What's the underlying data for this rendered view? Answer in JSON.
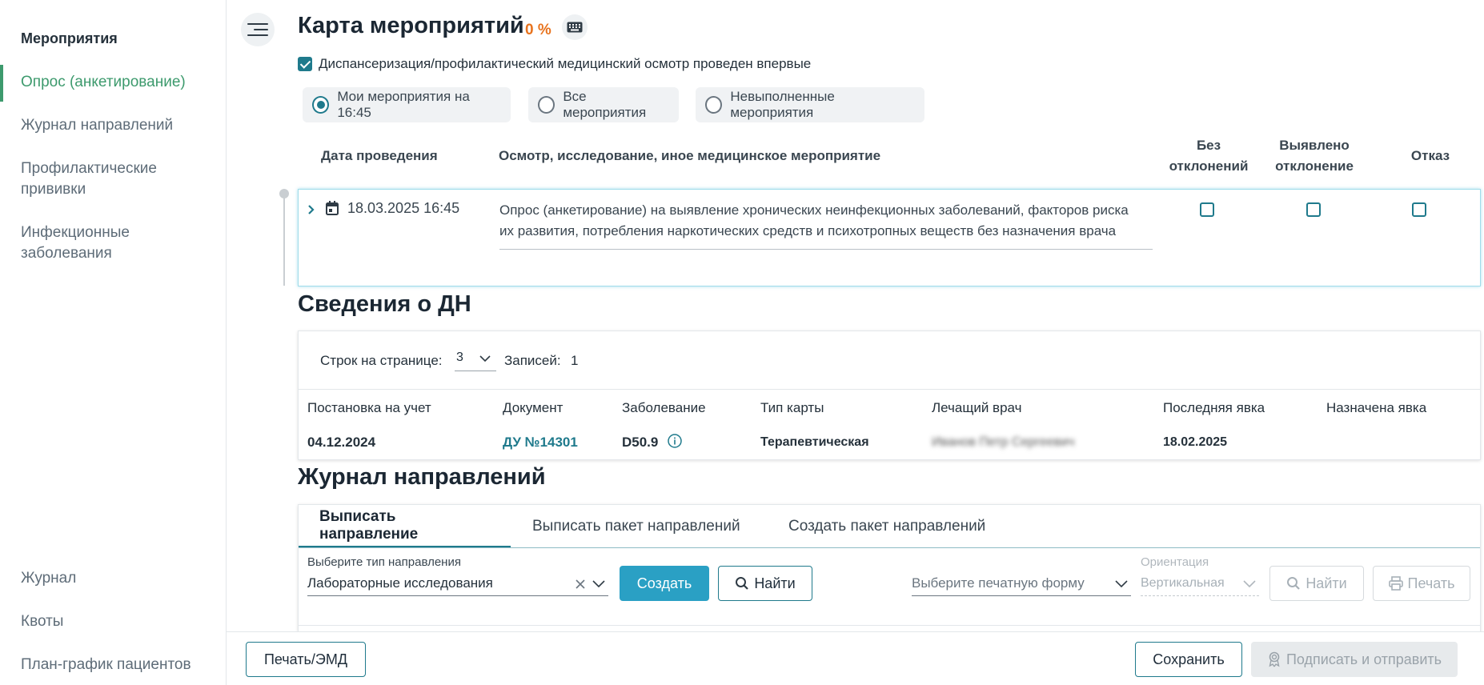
{
  "sidebar": {
    "heading": "Мероприятия",
    "items": [
      {
        "label": "Опрос (анкетирование)",
        "active": true
      },
      {
        "label": "Журнал направлений"
      },
      {
        "label": "Профилактические прививки"
      },
      {
        "label": "Инфекционные заболевания"
      }
    ],
    "bottom_items": [
      {
        "label": "Журнал"
      },
      {
        "label": "Квоты"
      },
      {
        "label": "План-график пациентов"
      }
    ]
  },
  "events": {
    "title": "Карта мероприятий",
    "percent": "0 %",
    "first_exam_checkbox": {
      "label": "Диспансеризация/профилактический медицинский осмотр проведен впервые",
      "checked": true
    },
    "filters": [
      {
        "label": "Мои мероприятия на 16:45",
        "selected": true
      },
      {
        "label": "Все мероприятия",
        "selected": false
      },
      {
        "label": "Невыполненные мероприятия",
        "selected": false
      }
    ],
    "columns": {
      "date": "Дата проведения",
      "event": "Осмотр, исследование, иное медицинское мероприятие",
      "no_deviation_1": "Без",
      "no_deviation_2": "отклонений",
      "deviation_1": "Выявлено",
      "deviation_2": "отклонение",
      "refusal": "Отказ"
    },
    "row": {
      "date": "18.03.2025 16:45",
      "description_line1": "Опрос (анкетирование) на выявление хронических неинфекционных заболеваний, факторов риска",
      "description_line2": "их развития, потребления наркотических средств и психотропных веществ без назначения врача"
    }
  },
  "dn": {
    "title": "Сведения о ДН",
    "rows_per_page_label": "Строк на странице:",
    "rows_per_page_value": "3",
    "records_label": "Записей:",
    "records_value": "1",
    "columns": [
      "Постановка на учет",
      "Документ",
      "Заболевание",
      "Тип карты",
      "Лечащий врач",
      "Последняя явка",
      "Назначена явка"
    ],
    "row": {
      "registered": "04.12.2024",
      "document": "ДУ №14301",
      "disease": "D50.9",
      "card_type": "Терапевтическая",
      "doctor": "Иванов Петр Сергеевич",
      "last_visit": "18.02.2025",
      "next_visit": ""
    }
  },
  "journal": {
    "title": "Журнал направлений",
    "tabs": [
      "Выписать направление",
      "Выписать пакет направлений",
      "Создать пакет направлений"
    ],
    "type_label": "Выберите тип направления",
    "type_value": "Лабораторные исследования",
    "create_button": "Создать",
    "find_button": "Найти",
    "print_form_placeholder": "Выберите печатную форму",
    "orientation_label": "Ориентация",
    "orientation_value": "Вертикальная",
    "find_disabled": "Найти",
    "print_disabled": "Печать"
  },
  "footer": {
    "print_emd": "Печать/ЭМД",
    "save": "Сохранить",
    "sign_send": "Подписать и отправить"
  },
  "colors": {
    "accent": "#1f7a8c",
    "active_green": "#3d9a6d",
    "percent_orange": "#e8731e",
    "button_blue": "#2aa0c4"
  }
}
